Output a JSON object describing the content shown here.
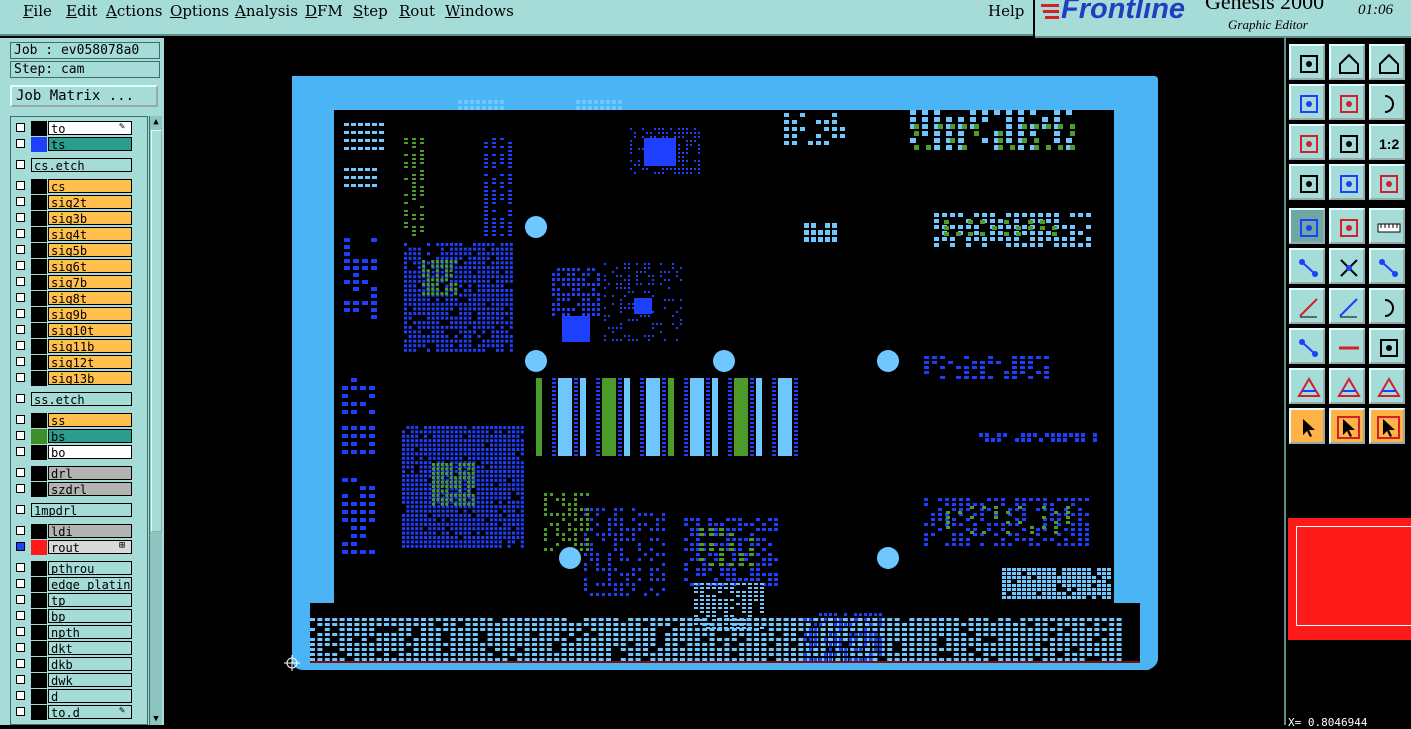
{
  "menubar": {
    "items": [
      "File",
      "Edit",
      "Actions",
      "Options",
      "Analysis",
      "DFM",
      "Step",
      "Rout",
      "Windows"
    ],
    "help": "Help"
  },
  "brand": {
    "logo": "Frontline",
    "product": "Genesis 2000",
    "subtitle": "Graphic Editor",
    "time": "01:06"
  },
  "job": {
    "job_label": "Job : ev058078a0",
    "step_label": "Step: cam",
    "matrix_button": "Job Matrix ..."
  },
  "layers": [
    {
      "name": "to",
      "color": "#ffffff",
      "swatch": "#000000",
      "edit": true
    },
    {
      "name": "ts",
      "color": "#2a9d8f",
      "swatch": "#1f3fff"
    },
    {
      "name": "cs.etch",
      "color": "#a6dcd8",
      "swatch": null
    },
    {
      "name": "cs",
      "color": "#ffc04d",
      "swatch": "#000000"
    },
    {
      "name": "sig2t",
      "color": "#ffc04d",
      "swatch": "#000000"
    },
    {
      "name": "sig3b",
      "color": "#ffc04d",
      "swatch": "#000000"
    },
    {
      "name": "sig4t",
      "color": "#ffc04d",
      "swatch": "#000000"
    },
    {
      "name": "sig5b",
      "color": "#ffc04d",
      "swatch": "#000000"
    },
    {
      "name": "sig6t",
      "color": "#ffc04d",
      "swatch": "#000000"
    },
    {
      "name": "sig7b",
      "color": "#ffc04d",
      "swatch": "#000000"
    },
    {
      "name": "sig8t",
      "color": "#ffc04d",
      "swatch": "#000000"
    },
    {
      "name": "sig9b",
      "color": "#ffc04d",
      "swatch": "#000000"
    },
    {
      "name": "sig10t",
      "color": "#ffc04d",
      "swatch": "#000000"
    },
    {
      "name": "sig11b",
      "color": "#ffc04d",
      "swatch": "#000000"
    },
    {
      "name": "sig12t",
      "color": "#ffc04d",
      "swatch": "#000000"
    },
    {
      "name": "sig13b",
      "color": "#ffc04d",
      "swatch": "#000000"
    },
    {
      "name": "ss.etch",
      "color": "#a6dcd8",
      "swatch": null
    },
    {
      "name": "ss",
      "color": "#ffc04d",
      "swatch": "#000000"
    },
    {
      "name": "bs",
      "color": "#2a9d8f",
      "swatch": "#3d8f2a"
    },
    {
      "name": "bo",
      "color": "#ffffff",
      "swatch": "#000000"
    },
    {
      "name": "drl",
      "color": "#b3b3b3",
      "swatch": "#000000"
    },
    {
      "name": "szdrl",
      "color": "#b3b3b3",
      "swatch": "#000000"
    },
    {
      "name": "1mpdrl",
      "color": "#a6dcd8",
      "swatch": null
    },
    {
      "name": "ldi",
      "color": "#b3b3b3",
      "swatch": "#000000"
    },
    {
      "name": "rout",
      "color": "#d9d9d9",
      "swatch": "#ff1a1a",
      "mark": "⊞",
      "checked": true
    },
    {
      "name": "pthrou",
      "color": "#a6dcd8",
      "swatch": "#000000"
    },
    {
      "name": "edge_plating",
      "color": "#a6dcd8",
      "swatch": "#000000"
    },
    {
      "name": "tp",
      "color": "#a6dcd8",
      "swatch": "#000000"
    },
    {
      "name": "bp",
      "color": "#a6dcd8",
      "swatch": "#000000"
    },
    {
      "name": "npth",
      "color": "#a6dcd8",
      "swatch": "#000000"
    },
    {
      "name": "dkt",
      "color": "#a6dcd8",
      "swatch": "#000000"
    },
    {
      "name": "dkb",
      "color": "#a6dcd8",
      "swatch": "#000000"
    },
    {
      "name": "dwk",
      "color": "#a6dcd8",
      "swatch": "#000000"
    },
    {
      "name": "d",
      "color": "#a6dcd8",
      "swatch": "#000000"
    },
    {
      "name": "to.d",
      "color": "#a6dcd8",
      "swatch": "#000000",
      "edit": true
    }
  ],
  "colors": {
    "panel": "#a6dcd8",
    "frame": "#4bb4f5",
    "pads_blue": "#1f3fff",
    "pads_light": "#6ec8ff",
    "pads_green": "#4d9b2a",
    "rout": "#ff1a1a"
  },
  "tools": [
    "snapshot-icon",
    "zoom-home-icon",
    "home-icon",
    "pan-left-icon",
    "pan-right-icon",
    "undo-view-icon",
    "zoom-fit-icon",
    "zoom-center-icon",
    "scale-1-2-icon",
    "palette-icon",
    "grid-icon",
    "layers-icon",
    "measure-icon",
    "move-icon",
    "ruler-icon",
    "connect-icon",
    "cross-icon",
    "line-icon",
    "slash-icon",
    "slash-red-icon",
    "arc-icon",
    "node-icon",
    "minus-icon",
    "distance-icon",
    "triangle-icon",
    "triangle-a-icon",
    "triangle-b-icon",
    "pointer-icon",
    "pointer-select-icon",
    "pointer-add-icon"
  ],
  "scale_label": "1:2",
  "coordinate": "X= 0.8046944"
}
